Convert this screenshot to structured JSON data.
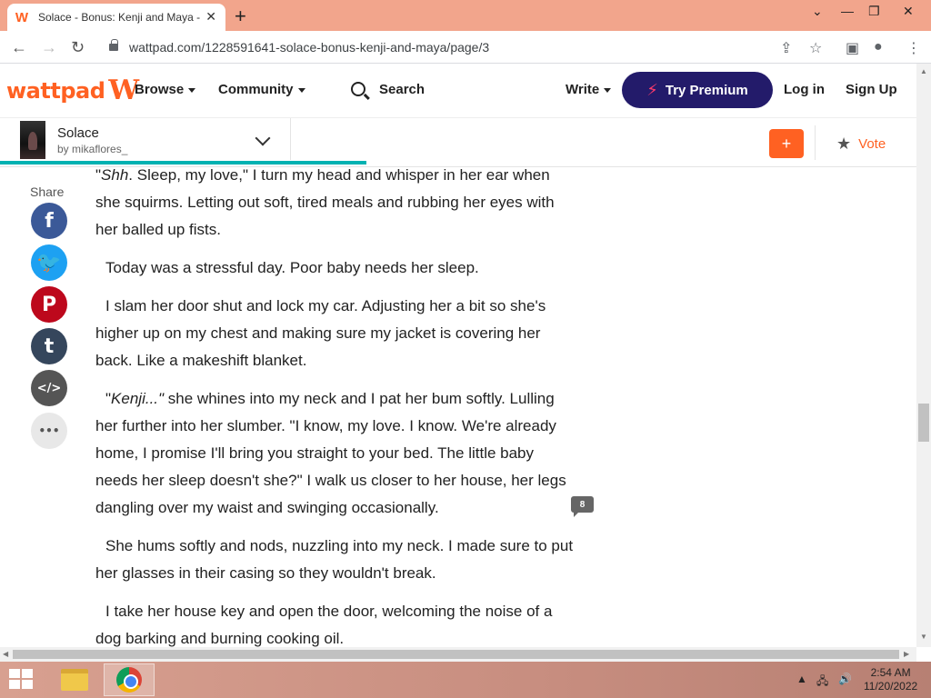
{
  "browser": {
    "tab_title": "Solace - Bonus: Kenji and Maya -",
    "tab_favicon": "W",
    "tab_close": "✕",
    "new_tab": "+",
    "url": "wattpad.com/1228591641-solace-bonus-kenji-and-maya/page/3",
    "icons": [
      "back-arrow-icon",
      "forward-arrow-icon",
      "reload-icon",
      "lock-icon",
      "share-icon",
      "bookmark-star-icon",
      "sidebar-icon",
      "profile-icon",
      "more-menu-icon"
    ],
    "window_controls": [
      "minimize",
      "restore",
      "close"
    ]
  },
  "header": {
    "logo_text": "wattpad",
    "logo_mark": "W",
    "nav": {
      "browse": "Browse",
      "community": "Community",
      "search": "Search",
      "write": "Write",
      "premium": "Try Premium",
      "login": "Log in",
      "signup": "Sign Up"
    }
  },
  "story": {
    "title": "Solace",
    "author": "by mikaflores_",
    "add_label": "+",
    "vote_label": "Vote",
    "progress_fraction": 0.4
  },
  "share": {
    "label": "Share",
    "buttons": [
      {
        "name": "facebook-icon",
        "glyph": "f",
        "color": "#3b5998"
      },
      {
        "name": "twitter-icon",
        "glyph": "🐦",
        "color": "#1da1f2"
      },
      {
        "name": "pinterest-icon",
        "glyph": "P",
        "color": "#bd081c"
      },
      {
        "name": "tumblr-icon",
        "glyph": "t",
        "color": "#35465c"
      },
      {
        "name": "embed-icon",
        "glyph": "</>",
        "color": "#555555"
      },
      {
        "name": "more-icon",
        "glyph": "•••",
        "color": "#e8e8e8"
      }
    ]
  },
  "reader": {
    "p1_open": "\"",
    "p1_em": "Shh",
    "p1_rest": ". Sleep, my love,\" I turn my head and whisper in her ear when she squirms. Letting out soft, tired meals and rubbing her eyes with her balled up fists.",
    "p2": "Today was a stressful day. Poor baby needs her sleep.",
    "p3": "I slam her door shut and lock my car. Adjusting her a bit so she's higher up on my chest and making sure my jacket is covering her back. Like a makeshift blanket.",
    "p4_open": "\"",
    "p4_em": "Kenji...\"",
    "p4_rest": " she whines into my neck and I pat her bum softly. Lulling her further into her slumber. \"I know, my love. I know. We're already home, I promise I'll bring you straight to your bed. The little baby needs her sleep doesn't she?\" I walk us closer to her house, her legs dangling over my waist and swinging occasionally.",
    "p5": "She hums softly and nods, nuzzling into my neck. I made sure to put her glasses in their casing so they wouldn't break.",
    "p6": "I take her house key and open the door, welcoming the noise of a dog barking and burning cooking oil.",
    "comment_count": "8"
  },
  "taskbar": {
    "time": "2:54 AM",
    "date": "11/20/2022",
    "apps": [
      "file-explorer-icon",
      "chrome-icon"
    ]
  }
}
